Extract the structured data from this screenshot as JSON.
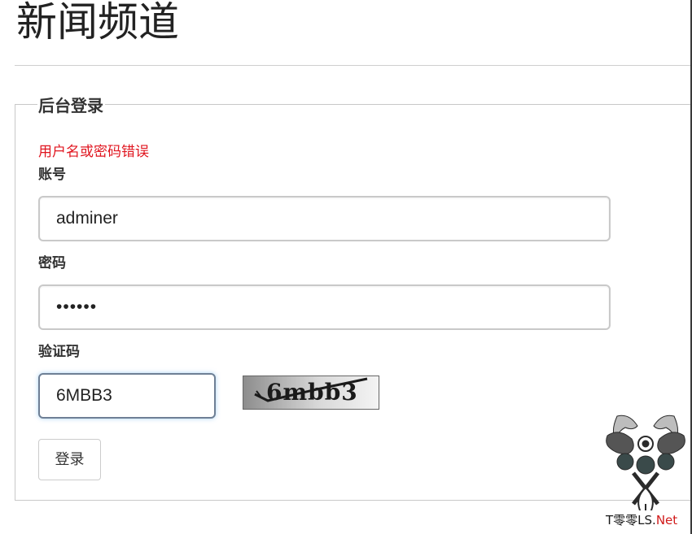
{
  "header": {
    "title": "新闻频道"
  },
  "login_form": {
    "legend": "后台登录",
    "error_message": "用户名或密码错误",
    "username": {
      "label": "账号",
      "value": "adminer"
    },
    "password": {
      "label": "密码",
      "value": "••••••"
    },
    "captcha": {
      "label": "验证码",
      "value": "6MBB3",
      "image_text": "6mbb3"
    },
    "submit_label": "登录"
  },
  "watermark": {
    "text_prefix": "T零零LS.",
    "text_suffix": "Net"
  },
  "colors": {
    "error": "#e0141e",
    "focus_border": "#6e7f95",
    "text": "#333333"
  }
}
